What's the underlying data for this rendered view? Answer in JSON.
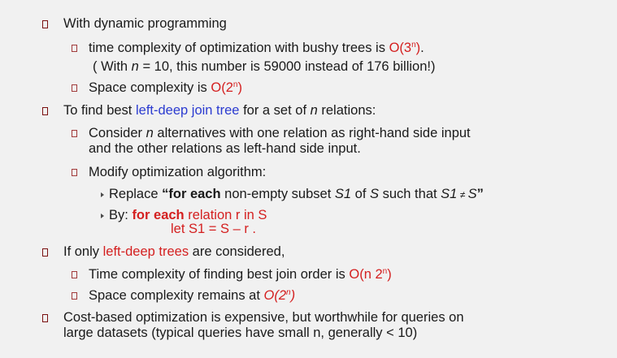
{
  "items": {
    "dp_heading": "With dynamic programming",
    "time_bushy": {
      "text": "time complexity of optimization with bushy trees is ",
      "o_pre": "O(3",
      "sup": "n",
      "o_post": ")",
      "end": "."
    },
    "with_n_note": {
      "pre": "( With ",
      "n": "n",
      "post": " = 10, this number is 59000 instead of 176 billion!)"
    },
    "space_cplx": {
      "text": "Space complexity is ",
      "o_pre": "O(2",
      "sup": "n",
      "o_post": ")"
    },
    "find_left_deep": {
      "pre": "To find best ",
      "link": "left-deep join tree",
      "mid": " for a set of ",
      "n": "n",
      "post": " relations:"
    },
    "consider_n": {
      "pre": "Consider ",
      "n": "n",
      "post": " alternatives with one relation as right-hand side input",
      "line2": "and the other relations as left-hand side input."
    },
    "modify_alg": "Modify optimization algorithm:",
    "replace": {
      "pre": "Replace ",
      "q_open": "“",
      "bold": "for each",
      "mid": " non-empty subset ",
      "s1": "S1",
      "of": " of ",
      "s": "S",
      "such": " such that ",
      "s1b": "S1",
      "neq": " ≠ ",
      "s2": "S",
      "q_close": "”"
    },
    "by": {
      "pre": "By:  ",
      "bold": "for each",
      "post": " relation r in S",
      "line2": "let S1 = S – r ."
    },
    "if_only": {
      "pre": "If only ",
      "red": "left-deep trees",
      "post": " are considered,"
    },
    "time_left_deep": {
      "text": "Time complexity of finding best join order is ",
      "o_pre": "O(n 2",
      "sup": "n",
      "o_post": ")"
    },
    "space_remains": {
      "text": "Space complexity remains at ",
      "o_pre": "O(2",
      "sup": "n",
      "o_post": ")"
    },
    "cost_based": {
      "line1": "Cost-based optimization is expensive, but worthwhile for queries on",
      "line2": "large datasets (typical queries have small n, generally < 10)"
    }
  },
  "colors": {
    "accent_red": "#d42020",
    "link_blue": "#2b3bd0",
    "bullet": "#7a1010"
  }
}
